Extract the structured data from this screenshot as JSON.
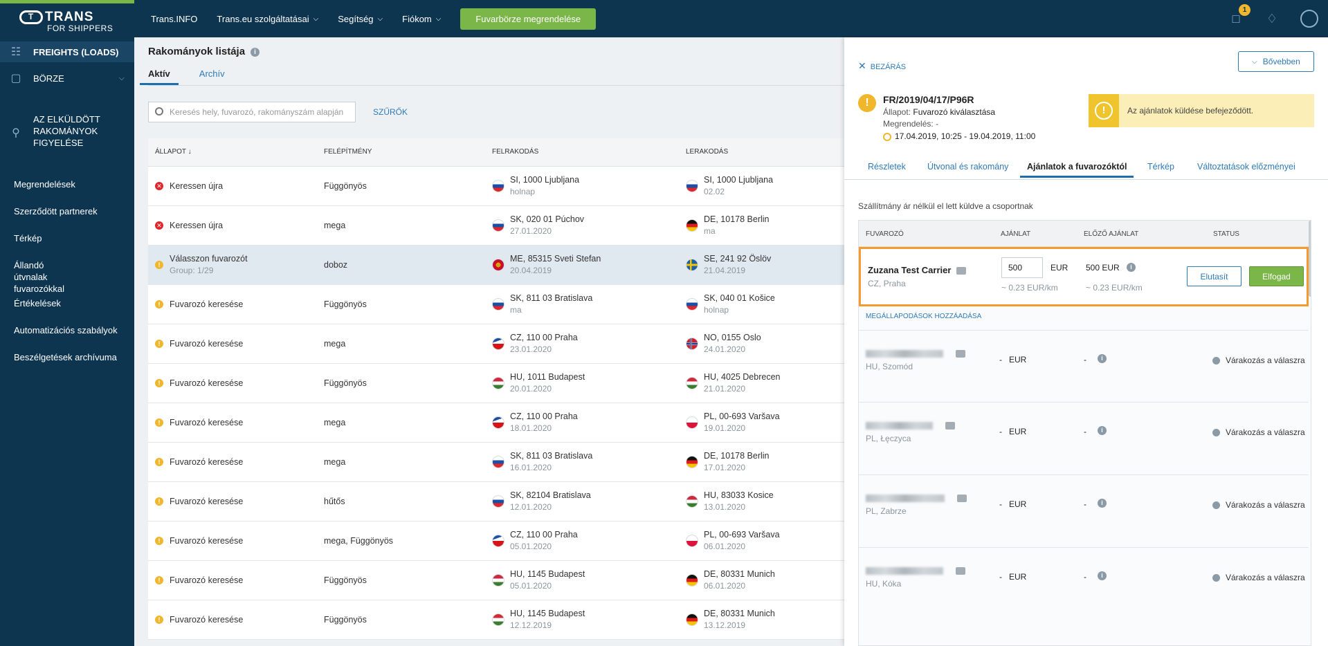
{
  "app": {
    "logo_top": "TRANS",
    "logo_ring": "T",
    "logo_bottom": "FOR SHIPPERS"
  },
  "topnav": {
    "items": [
      {
        "label": "Trans.INFO",
        "has_chevron": false
      },
      {
        "label": "Trans.eu szolgáltatásai",
        "has_chevron": true
      },
      {
        "label": "Segítség",
        "has_chevron": true
      },
      {
        "label": "Fiókom",
        "has_chevron": true
      }
    ],
    "order_button": "Fuvarbörze megrendelése",
    "messages_badge": "1"
  },
  "sidebar": {
    "main": [
      {
        "label": "FREIGHTS (LOADS)",
        "icon": "freight-icon"
      },
      {
        "label": "BÖRZE",
        "icon": "box-icon"
      },
      {
        "label": "AZ ELKÜLDÖTT RAKOMÁNYOK FIGYELÉSE",
        "icon": "tracking-icon"
      }
    ],
    "sub": [
      "Megrendelések",
      "Szerződött partnerek",
      "Térkép",
      "Állandó útvnalak fuvarozókkal",
      "Értékelések",
      "Automatizációs szabályok",
      "Beszélgetések archívuma"
    ]
  },
  "list": {
    "title": "Rakományok listája",
    "tabs": [
      "Aktív",
      "Archív"
    ],
    "search_placeholder": "Keresés hely, fuvarozó, rakományszám alapján",
    "filter": "SZŰRŐK",
    "columns": [
      "ÁLLAPOT ↓",
      "FELÉPÍTMÉNY",
      "FELRAKODÁS",
      "LERAKODÁS"
    ],
    "rows": [
      {
        "status": "Keressen újra",
        "status_type": "error",
        "sub": "",
        "body": "Függönyös",
        "from": "SI, 1000 Ljubljana",
        "from_date": "holnap",
        "from_flag": "SI",
        "to": "SI, 1000 Ljubljana",
        "to_date": "02.02",
        "to_flag": "SI"
      },
      {
        "status": "Keressen újra",
        "status_type": "error",
        "sub": "",
        "body": "mega",
        "from": "SK, 020 01 Púchov",
        "from_date": "27.01.2020",
        "from_flag": "SK",
        "to": "DE, 10178 Berlin",
        "to_date": "ma",
        "to_flag": "DE"
      },
      {
        "status": "Válasszon fuvarozót",
        "status_type": "warn",
        "sub": "Group: 1/29",
        "body": "doboz",
        "from": "ME, 85315 Sveti Stefan",
        "from_date": "20.04.2019",
        "from_flag": "ME",
        "to": "SE, 241 92 Öslöv",
        "to_date": "21.04.2019",
        "to_flag": "SE",
        "selected": true
      },
      {
        "status": "Fuvarozó keresése",
        "status_type": "warn",
        "sub": "",
        "body": "Függönyös",
        "from": "SK, 811 03 Bratislava",
        "from_date": "ma",
        "from_flag": "SK",
        "to": "SK, 040 01 Košice",
        "to_date": "holnap",
        "to_flag": "SK"
      },
      {
        "status": "Fuvarozó keresése",
        "status_type": "warn",
        "sub": "",
        "body": "mega",
        "from": "CZ, 110 00 Praha",
        "from_date": "23.01.2020",
        "from_flag": "CZ",
        "to": "NO, 0155 Oslo",
        "to_date": "24.01.2020",
        "to_flag": "NO"
      },
      {
        "status": "Fuvarozó keresése",
        "status_type": "warn",
        "sub": "",
        "body": "Függönyös",
        "from": "HU, 1011 Budapest",
        "from_date": "20.01.2020",
        "from_flag": "HU",
        "to": "HU, 4025 Debrecen",
        "to_date": "21.01.2020",
        "to_flag": "HU"
      },
      {
        "status": "Fuvarozó keresése",
        "status_type": "warn",
        "sub": "",
        "body": "mega",
        "from": "CZ, 110 00 Praha",
        "from_date": "18.01.2020",
        "from_flag": "CZ",
        "to": "PL, 00-693 Varšava",
        "to_date": "19.01.2020",
        "to_flag": "PL"
      },
      {
        "status": "Fuvarozó keresése",
        "status_type": "warn",
        "sub": "",
        "body": "mega",
        "from": "SK, 811 03 Bratislava",
        "from_date": "16.01.2020",
        "from_flag": "SK",
        "to": "DE, 10178 Berlin",
        "to_date": "17.01.2020",
        "to_flag": "DE"
      },
      {
        "status": "Fuvarozó keresése",
        "status_type": "warn",
        "sub": "",
        "body": "hűtős",
        "from": "SK, 82104 Bratislava",
        "from_date": "12.01.2020",
        "from_flag": "SK",
        "to": "HU, 83033 Kosice",
        "to_date": "13.01.2020",
        "to_flag": "HU"
      },
      {
        "status": "Fuvarozó keresése",
        "status_type": "warn",
        "sub": "",
        "body": "mega, Függönyös",
        "from": "CZ, 110 00 Praha",
        "from_date": "05.01.2020",
        "from_flag": "CZ",
        "to": "PL, 00-693 Varšava",
        "to_date": "06.01.2020",
        "to_flag": "PL"
      },
      {
        "status": "Fuvarozó keresése",
        "status_type": "warn",
        "sub": "",
        "body": "Függönyös",
        "from": "HU, 1145 Budapest",
        "from_date": "05.01.2020",
        "from_flag": "HU",
        "to": "DE, 80331 Munich",
        "to_date": "06.01.2020",
        "to_flag": "DE"
      },
      {
        "status": "Fuvarozó keresése",
        "status_type": "warn",
        "sub": "",
        "body": "Függönyös",
        "from": "HU, 1145 Budapest",
        "from_date": "12.12.2019",
        "from_flag": "HU",
        "to": "DE, 80331 Munich",
        "to_date": "13.12.2019",
        "to_flag": "DE"
      }
    ]
  },
  "panel": {
    "close": "BEZÁRÁS",
    "more": "Bővebben",
    "freight_id": "FR/2019/04/17/P96R",
    "state_label": "Állapot:",
    "state_value": "Fuvarozó kiválasztása",
    "order_label": "Megrendelés:",
    "order_value": "-",
    "dates": "17.04.2019, 10:25 - 19.04.2019, 11:00",
    "alert": "Az ajánlatok küldése befejeződött.",
    "tabs": [
      "Részletek",
      "Útvonal és rakomány",
      "Ajánlatok a fuvarozóktól",
      "Térkép",
      "Változtatások előzményei"
    ],
    "active_tab": 2,
    "note": "Szállítmány ár nélkül el lett küldve a csoportnak",
    "columns": [
      "FUVAROZÓ",
      "AJÁNLAT",
      "ELŐZŐ AJÁNLAT",
      "STATUS"
    ],
    "first_offer": {
      "carrier": "Zuzana Test Carrier",
      "city": "CZ, Praha",
      "price": "500",
      "currency": "EUR",
      "per_km": "~ 0.23  EUR/km",
      "prev_price": "500  EUR",
      "prev_per_km": "~ 0.23  EUR/km",
      "reject": "Elutasít",
      "accept": "Elfogad"
    },
    "add_agreements": "MEGÁLLAPODÁSOK HOZZÁADÁSA",
    "other_offers": [
      {
        "city": "HU, Szomód",
        "offer": "-",
        "currency": "EUR",
        "prev": "-",
        "status": "Várakozás a válaszra"
      },
      {
        "city": "PL, Łęczyca",
        "offer": "-",
        "currency": "EUR",
        "prev": "-",
        "status": "Várakozás a válaszra"
      },
      {
        "city": "PL, Zabrze",
        "offer": "-",
        "currency": "EUR",
        "prev": "-",
        "status": "Várakozás a válaszra"
      },
      {
        "city": "HU, Kóka",
        "offer": "-",
        "currency": "EUR",
        "prev": "-",
        "status": "Várakozás a válaszra"
      }
    ]
  },
  "colors": {
    "navy": "#0e3550",
    "green": "#7ab648",
    "highlight": "#f59a2f",
    "warn": "#f0b62c",
    "error": "#e0262d",
    "link": "#2f7ab5"
  }
}
